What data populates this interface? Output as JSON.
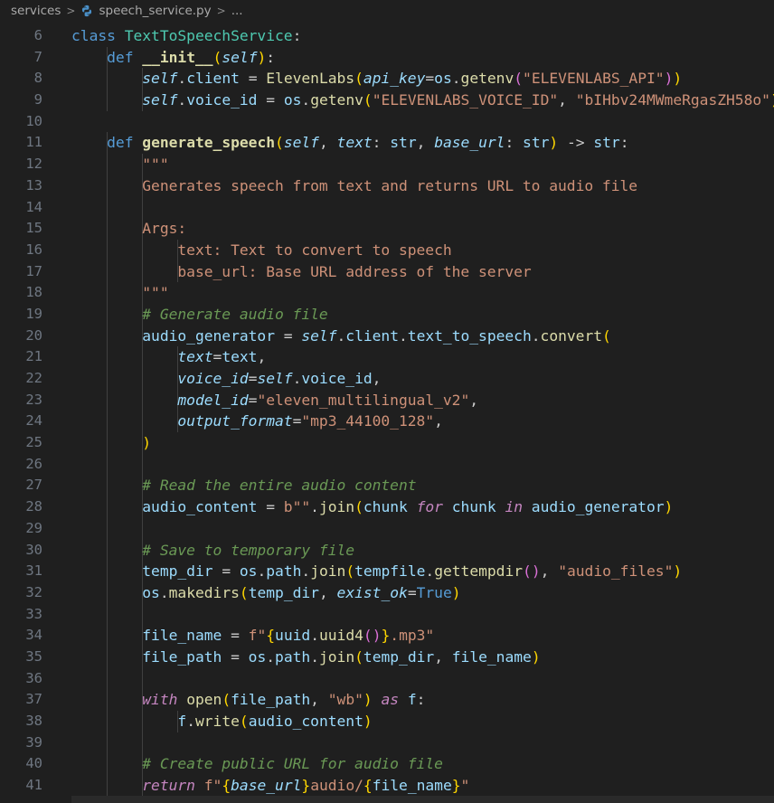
{
  "breadcrumb": {
    "folder": "services",
    "file": "speech_service.py",
    "ellipsis": "..."
  },
  "editor": {
    "lines": [
      {
        "n": "6",
        "indent": 0,
        "tokens": [
          [
            "kw",
            "class "
          ],
          [
            "cls",
            "TextToSpeechService"
          ],
          [
            "plain",
            ":"
          ]
        ]
      },
      {
        "n": "7",
        "indent": 1,
        "tokens": [
          [
            "kw",
            "def "
          ],
          [
            "fn bold",
            "__init__"
          ],
          [
            "brk1",
            "("
          ],
          [
            "self",
            "self"
          ],
          [
            "brk1",
            ")"
          ],
          [
            "plain",
            ":"
          ]
        ]
      },
      {
        "n": "8",
        "indent": 2,
        "tokens": [
          [
            "self",
            "self"
          ],
          [
            "plain",
            "."
          ],
          [
            "var",
            "client"
          ],
          [
            "plain",
            " = "
          ],
          [
            "fn",
            "ElevenLabs"
          ],
          [
            "brk1",
            "("
          ],
          [
            "param",
            "api_key"
          ],
          [
            "plain",
            "="
          ],
          [
            "var",
            "os"
          ],
          [
            "plain",
            "."
          ],
          [
            "fn",
            "getenv"
          ],
          [
            "brk2",
            "("
          ],
          [
            "str",
            "\"ELEVENLABS_API\""
          ],
          [
            "brk2",
            ")"
          ],
          [
            "brk1",
            ")"
          ]
        ]
      },
      {
        "n": "9",
        "indent": 2,
        "tokens": [
          [
            "self",
            "self"
          ],
          [
            "plain",
            "."
          ],
          [
            "var",
            "voice_id"
          ],
          [
            "plain",
            " = "
          ],
          [
            "var",
            "os"
          ],
          [
            "plain",
            "."
          ],
          [
            "fn",
            "getenv"
          ],
          [
            "brk1",
            "("
          ],
          [
            "str",
            "\"ELEVENLABS_VOICE_ID\""
          ],
          [
            "plain",
            ", "
          ],
          [
            "str",
            "\"bIHbv24MWmeRgasZH58o\""
          ],
          [
            "brk1",
            ")"
          ]
        ]
      },
      {
        "n": "10",
        "indent": 0,
        "tokens": []
      },
      {
        "n": "11",
        "indent": 1,
        "tokens": [
          [
            "kw",
            "def "
          ],
          [
            "fn bold",
            "generate_speech"
          ],
          [
            "brk1",
            "("
          ],
          [
            "self",
            "self"
          ],
          [
            "plain",
            ", "
          ],
          [
            "param",
            "text"
          ],
          [
            "plain",
            ": "
          ],
          [
            "var",
            "str"
          ],
          [
            "plain",
            ", "
          ],
          [
            "param",
            "base_url"
          ],
          [
            "plain",
            ": "
          ],
          [
            "var",
            "str"
          ],
          [
            "brk1",
            ")"
          ],
          [
            "plain",
            " -> "
          ],
          [
            "var",
            "str"
          ],
          [
            "plain",
            ":"
          ]
        ]
      },
      {
        "n": "12",
        "indent": 2,
        "tokens": [
          [
            "doc",
            "\"\"\""
          ]
        ]
      },
      {
        "n": "13",
        "indent": 2,
        "tokens": [
          [
            "doc",
            "Generates speech from text and returns URL to audio file"
          ]
        ]
      },
      {
        "n": "14",
        "indent": 2,
        "tokens": []
      },
      {
        "n": "15",
        "indent": 2,
        "tokens": [
          [
            "doc",
            "Args:"
          ]
        ]
      },
      {
        "n": "16",
        "indent": 3,
        "tokens": [
          [
            "doc",
            "text: Text to convert to speech"
          ]
        ]
      },
      {
        "n": "17",
        "indent": 3,
        "tokens": [
          [
            "doc",
            "base_url: Base URL address of the server"
          ]
        ]
      },
      {
        "n": "18",
        "indent": 2,
        "tokens": [
          [
            "doc",
            "\"\"\""
          ]
        ]
      },
      {
        "n": "19",
        "indent": 2,
        "tokens": [
          [
            "com",
            "# Generate audio file"
          ]
        ]
      },
      {
        "n": "20",
        "indent": 2,
        "tokens": [
          [
            "var",
            "audio_generator"
          ],
          [
            "plain",
            " = "
          ],
          [
            "self",
            "self"
          ],
          [
            "plain",
            "."
          ],
          [
            "var",
            "client"
          ],
          [
            "plain",
            "."
          ],
          [
            "var",
            "text_to_speech"
          ],
          [
            "plain",
            "."
          ],
          [
            "fn",
            "convert"
          ],
          [
            "brk1",
            "("
          ]
        ]
      },
      {
        "n": "21",
        "indent": 3,
        "tokens": [
          [
            "param",
            "text"
          ],
          [
            "plain",
            "="
          ],
          [
            "var",
            "text"
          ],
          [
            "plain",
            ","
          ]
        ]
      },
      {
        "n": "22",
        "indent": 3,
        "tokens": [
          [
            "param",
            "voice_id"
          ],
          [
            "plain",
            "="
          ],
          [
            "self",
            "self"
          ],
          [
            "plain",
            "."
          ],
          [
            "var",
            "voice_id"
          ],
          [
            "plain",
            ","
          ]
        ]
      },
      {
        "n": "23",
        "indent": 3,
        "tokens": [
          [
            "param",
            "model_id"
          ],
          [
            "plain",
            "="
          ],
          [
            "str",
            "\"eleven_multilingual_v2\""
          ],
          [
            "plain",
            ","
          ]
        ]
      },
      {
        "n": "24",
        "indent": 3,
        "tokens": [
          [
            "param",
            "output_format"
          ],
          [
            "plain",
            "="
          ],
          [
            "str",
            "\"mp3_44100_128\""
          ],
          [
            "plain",
            ","
          ]
        ]
      },
      {
        "n": "25",
        "indent": 2,
        "tokens": [
          [
            "brk1",
            ")"
          ]
        ]
      },
      {
        "n": "26",
        "indent": 2,
        "tokens": []
      },
      {
        "n": "27",
        "indent": 2,
        "tokens": [
          [
            "com",
            "# Read the entire audio content"
          ]
        ]
      },
      {
        "n": "28",
        "indent": 2,
        "tokens": [
          [
            "var",
            "audio_content"
          ],
          [
            "plain",
            " = "
          ],
          [
            "str",
            "b\"\""
          ],
          [
            "plain",
            "."
          ],
          [
            "fn",
            "join"
          ],
          [
            "brk1",
            "("
          ],
          [
            "var",
            "chunk "
          ],
          [
            "ctrl",
            "for"
          ],
          [
            "var",
            " chunk "
          ],
          [
            "ctrl",
            "in"
          ],
          [
            "var",
            " audio_generator"
          ],
          [
            "brk1",
            ")"
          ]
        ]
      },
      {
        "n": "29",
        "indent": 2,
        "tokens": []
      },
      {
        "n": "30",
        "indent": 2,
        "tokens": [
          [
            "com",
            "# Save to temporary file"
          ]
        ]
      },
      {
        "n": "31",
        "indent": 2,
        "tokens": [
          [
            "var",
            "temp_dir"
          ],
          [
            "plain",
            " = "
          ],
          [
            "var",
            "os"
          ],
          [
            "plain",
            "."
          ],
          [
            "var",
            "path"
          ],
          [
            "plain",
            "."
          ],
          [
            "fn",
            "join"
          ],
          [
            "brk1",
            "("
          ],
          [
            "var",
            "tempfile"
          ],
          [
            "plain",
            "."
          ],
          [
            "fn",
            "gettempdir"
          ],
          [
            "brk2",
            "()"
          ],
          [
            "plain",
            ", "
          ],
          [
            "str",
            "\"audio_files\""
          ],
          [
            "brk1",
            ")"
          ]
        ]
      },
      {
        "n": "32",
        "indent": 2,
        "tokens": [
          [
            "var",
            "os"
          ],
          [
            "plain",
            "."
          ],
          [
            "fn",
            "makedirs"
          ],
          [
            "brk1",
            "("
          ],
          [
            "var",
            "temp_dir"
          ],
          [
            "plain",
            ", "
          ],
          [
            "param",
            "exist_ok"
          ],
          [
            "plain",
            "="
          ],
          [
            "kw",
            "True"
          ],
          [
            "brk1",
            ")"
          ]
        ]
      },
      {
        "n": "33",
        "indent": 2,
        "tokens": []
      },
      {
        "n": "34",
        "indent": 2,
        "tokens": [
          [
            "var",
            "file_name"
          ],
          [
            "plain",
            " = "
          ],
          [
            "str",
            "f\""
          ],
          [
            "brk1",
            "{"
          ],
          [
            "var",
            "uuid"
          ],
          [
            "plain",
            "."
          ],
          [
            "fn",
            "uuid4"
          ],
          [
            "brk2",
            "()"
          ],
          [
            "brk1",
            "}"
          ],
          [
            "str",
            ".mp3\""
          ]
        ]
      },
      {
        "n": "35",
        "indent": 2,
        "tokens": [
          [
            "var",
            "file_path"
          ],
          [
            "plain",
            " = "
          ],
          [
            "var",
            "os"
          ],
          [
            "plain",
            "."
          ],
          [
            "var",
            "path"
          ],
          [
            "plain",
            "."
          ],
          [
            "fn",
            "join"
          ],
          [
            "brk1",
            "("
          ],
          [
            "var",
            "temp_dir"
          ],
          [
            "plain",
            ", "
          ],
          [
            "var",
            "file_name"
          ],
          [
            "brk1",
            ")"
          ]
        ]
      },
      {
        "n": "36",
        "indent": 2,
        "tokens": []
      },
      {
        "n": "37",
        "indent": 2,
        "tokens": [
          [
            "ctrl",
            "with "
          ],
          [
            "fn",
            "open"
          ],
          [
            "brk1",
            "("
          ],
          [
            "var",
            "file_path"
          ],
          [
            "plain",
            ", "
          ],
          [
            "str",
            "\"wb\""
          ],
          [
            "brk1",
            ")"
          ],
          [
            "ctrl",
            " as "
          ],
          [
            "var",
            "f"
          ],
          [
            "plain",
            ":"
          ]
        ]
      },
      {
        "n": "38",
        "indent": 3,
        "tokens": [
          [
            "var",
            "f"
          ],
          [
            "plain",
            "."
          ],
          [
            "fn",
            "write"
          ],
          [
            "brk1",
            "("
          ],
          [
            "var",
            "audio_content"
          ],
          [
            "brk1",
            ")"
          ]
        ]
      },
      {
        "n": "39",
        "indent": 2,
        "tokens": []
      },
      {
        "n": "40",
        "indent": 2,
        "tokens": [
          [
            "com",
            "# Create public URL for audio file"
          ]
        ]
      },
      {
        "n": "41",
        "indent": 2,
        "tokens": [
          [
            "ctrl",
            "return "
          ],
          [
            "str",
            "f\""
          ],
          [
            "brk1",
            "{"
          ],
          [
            "param",
            "base_url"
          ],
          [
            "brk1",
            "}"
          ],
          [
            "str",
            "audio/"
          ],
          [
            "brk1",
            "{"
          ],
          [
            "var",
            "file_name"
          ],
          [
            "brk1",
            "}"
          ],
          [
            "str",
            "\""
          ]
        ]
      }
    ]
  }
}
